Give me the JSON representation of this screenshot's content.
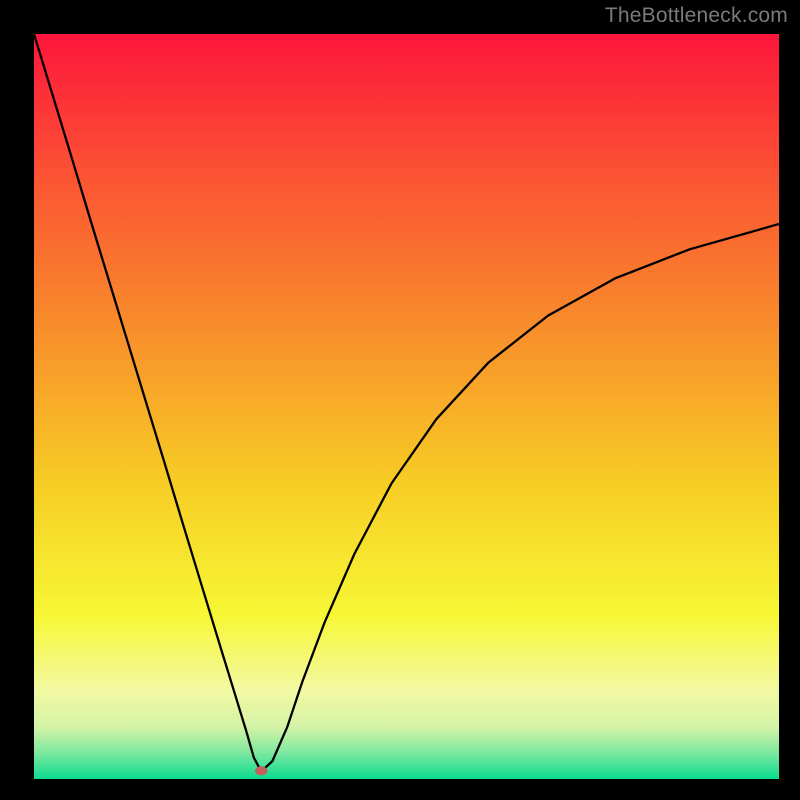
{
  "watermark": "TheBottleneck.com",
  "chart_data": {
    "type": "line",
    "title": "",
    "xlabel": "",
    "ylabel": "",
    "xlim": [
      0,
      100
    ],
    "ylim": [
      0,
      100
    ],
    "grid": false,
    "legend": false,
    "background_gradient": {
      "stops": [
        {
          "offset": 0.0,
          "color": "#fd163b"
        },
        {
          "offset": 0.2,
          "color": "#fb5633"
        },
        {
          "offset": 0.4,
          "color": "#f88f2b"
        },
        {
          "offset": 0.6,
          "color": "#f7cc25"
        },
        {
          "offset": 0.78,
          "color": "#f7f735"
        },
        {
          "offset": 0.88,
          "color": "#f3f9a1"
        },
        {
          "offset": 0.93,
          "color": "#d4f3a7"
        },
        {
          "offset": 0.965,
          "color": "#7de8a0"
        },
        {
          "offset": 1.0,
          "color": "#0bdc8e"
        }
      ]
    },
    "marker": {
      "x": 30.5,
      "y": 1.1,
      "color": "#c0615d"
    },
    "series": [
      {
        "name": "curve",
        "x": [
          0.0,
          2.5,
          5.0,
          7.5,
          10.0,
          12.5,
          15.0,
          17.5,
          20.0,
          22.5,
          25.0,
          27.0,
          28.5,
          29.5,
          30.5,
          32.0,
          34.0,
          36.0,
          39.0,
          43.0,
          48.0,
          54.0,
          61.0,
          69.0,
          78.0,
          88.0,
          100.0
        ],
        "y": [
          100.0,
          91.8,
          83.6,
          75.3,
          67.1,
          58.9,
          50.7,
          42.5,
          34.2,
          26.0,
          17.8,
          11.3,
          6.4,
          2.9,
          1.0,
          2.4,
          7.0,
          13.0,
          21.0,
          30.2,
          39.7,
          48.3,
          55.9,
          62.2,
          67.2,
          71.1,
          74.5
        ]
      }
    ]
  }
}
